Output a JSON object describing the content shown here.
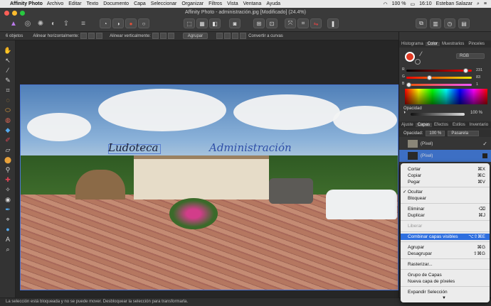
{
  "menubar": {
    "app": "Affinity Photo",
    "items": [
      "Archivo",
      "Editar",
      "Texto",
      "Documento",
      "Capa",
      "Seleccionar",
      "Organizar",
      "Filtros",
      "Vista",
      "Ventana",
      "Ayuda"
    ],
    "battery": "100 %",
    "clock": "16:10",
    "user": "Esteban Salazar"
  },
  "window": {
    "title": "Affinity Photo - administración.jpg [Modificado] (24.4%)"
  },
  "contextbar": {
    "objects": "6 objetos",
    "align_h": "Alinear horizontalmente:",
    "align_v": "Alinear verticalmente:",
    "group": "Agrupar",
    "convert": "Convertir a curvas"
  },
  "canvas": {
    "hand_text_1": "Ludoteca",
    "hand_text_2": "Administración"
  },
  "statusbar": {
    "text": "La selección está bloqueada y no se puede mover. Desbloquear la selección para transformarla."
  },
  "panel": {
    "tabs": [
      "Histograma",
      "Color",
      "Muestrarios",
      "Pinceles"
    ],
    "active_tab": "Color",
    "mode": "RGB",
    "rgb": [
      {
        "label": "R",
        "value": "231",
        "fraction": 0.906
      },
      {
        "label": "G",
        "value": "83",
        "fraction": 0.325
      },
      {
        "label": "B",
        "value": "1",
        "fraction": 0.004
      }
    ],
    "opacity_label": "Opacidad",
    "opacity_value": "100 %",
    "tabs2": [
      "Ajuste",
      "Capas",
      "Efectos",
      "Estilos",
      "Inventario"
    ],
    "active_tab2": "Capas",
    "layers_opacity_label": "Opacidad:",
    "layers_opacity": "100 %",
    "blend_mode": "Pasarela",
    "layers": [
      {
        "name": "(Píxel)",
        "selected": false
      },
      {
        "name": "(Píxel)",
        "selected": true
      }
    ]
  },
  "context_menu": {
    "items": [
      {
        "label": "Cortar",
        "shortcut": "⌘X",
        "state": "normal"
      },
      {
        "label": "Copiar",
        "shortcut": "⌘C",
        "state": "normal"
      },
      {
        "label": "Pegar",
        "shortcut": "⌘V",
        "state": "normal"
      },
      {
        "label": "Ocultar",
        "shortcut": "",
        "state": "checked"
      },
      {
        "label": "Bloquear",
        "shortcut": "",
        "state": "normal"
      },
      {
        "label": "Eliminar",
        "shortcut": "⌫",
        "state": "normal"
      },
      {
        "label": "Duplicar",
        "shortcut": "⌘J",
        "state": "normal"
      },
      {
        "label": "Liberar",
        "shortcut": "",
        "state": "disabled"
      },
      {
        "label": "Combinar capas visibles",
        "shortcut": "⌥⇧⌘E",
        "state": "highlighted"
      },
      {
        "label": "Agrupar",
        "shortcut": "⌘G",
        "state": "normal"
      },
      {
        "label": "Desagrupar",
        "shortcut": "⇧⌘G",
        "state": "normal"
      },
      {
        "label": "Rasterizar...",
        "shortcut": "",
        "state": "normal"
      },
      {
        "label": "Grupo de Capas",
        "shortcut": "",
        "state": "normal"
      },
      {
        "label": "Nueva capa de píxeles",
        "shortcut": "",
        "state": "normal"
      },
      {
        "label": "Expandir Selección",
        "shortcut": "",
        "state": "normal"
      }
    ]
  },
  "colors": {
    "accent": "#2f6fdf",
    "foreground_swatch": "#e03a24"
  }
}
